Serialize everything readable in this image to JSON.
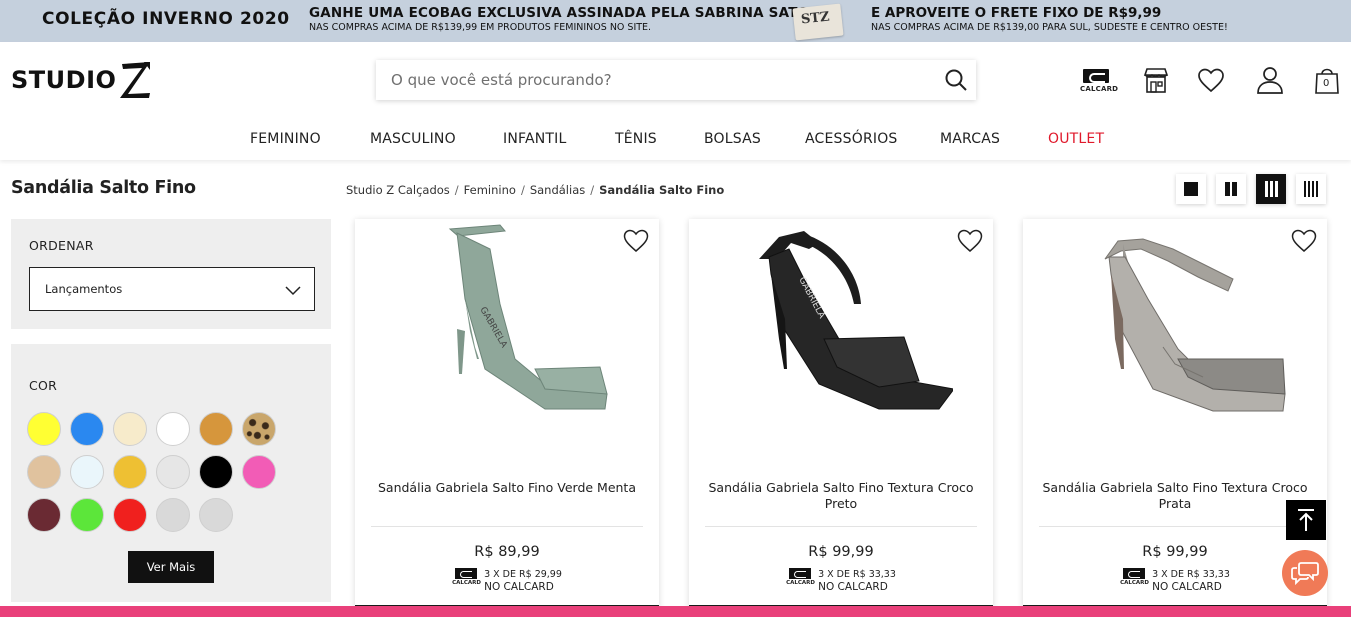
{
  "promo": {
    "left": "COLEÇÃO INVERNO 2020",
    "mid_big": "GANHE UMA ECOBAG EXCLUSIVA ASSINADA PELA SABRINA SATO",
    "mid_small": "NAS COMPRAS ACIMA DE R$139,99 EM PRODUTOS FEMININOS NO SITE.",
    "bag_label": "STZ",
    "right_big": "E APROVEITE O FRETE FIXO DE R$9,99",
    "right_small": "NAS COMPRAS ACIMA DE R$139,00 PARA SUL, SUDESTE E CENTRO OESTE!"
  },
  "header": {
    "logo_text": "STUDIO",
    "search_placeholder": "O que você está procurando?",
    "calcard_label": "CALCARD",
    "icons": [
      "calcard-icon",
      "store-icon",
      "heart-icon",
      "user-icon",
      "bag-icon"
    ],
    "cart_count": "0"
  },
  "nav": [
    {
      "label": "FEMININO"
    },
    {
      "label": "MASCULINO"
    },
    {
      "label": "INFANTIL"
    },
    {
      "label": "TÊNIS"
    },
    {
      "label": "BOLSAS"
    },
    {
      "label": "ACESSÓRIOS"
    },
    {
      "label": "MARCAS"
    },
    {
      "label": "OUTLET"
    }
  ],
  "page": {
    "title": "Sandália Salto Fino",
    "breadcrumb": [
      "Studio Z Calçados",
      "Feminino",
      "Sandálias",
      "Sandália Salto Fino"
    ]
  },
  "filters": {
    "sort_title": "ORDENAR",
    "sort_value": "Lançamentos",
    "color_title": "COR",
    "colors": [
      "#ffff33",
      "#2a88f0",
      "#f7ebcb",
      "#ffffff",
      "#d6963c",
      "leopard",
      "#e0c29e",
      "#eaf6fb",
      "#eec033",
      "#e6e6e6",
      "#000000",
      "#f25cb6",
      "#6a2a33",
      "#5ce63a",
      "#f0201e",
      "#d9d9d9",
      "#d9d9d9"
    ],
    "more_label": "Ver Mais"
  },
  "products": [
    {
      "name": "Sandália Gabriela Salto Fino Verde Menta",
      "price": "R$ 89,99",
      "installments": "3 X DE R$ 29,99",
      "installments_suffix": "NO CALCARD",
      "calcard_label": "CALCARD",
      "color": "#8fa79a"
    },
    {
      "name": "Sandália Gabriela Salto Fino Textura Croco Preto",
      "price": "R$ 99,99",
      "installments": "3 X DE R$ 33,33",
      "installments_suffix": "NO CALCARD",
      "calcard_label": "CALCARD",
      "color": "#1d1d1d"
    },
    {
      "name": "Sandália Gabriela Salto Fino Textura Croco Prata",
      "price": "R$ 99,99",
      "installments": "3 X DE R$ 33,33",
      "installments_suffix": "NO CALCARD",
      "calcard_label": "CALCARD",
      "color": "#9b9893"
    }
  ],
  "colors": {
    "promo_bg": "#c5d0dd",
    "outlet": "#e0192b",
    "chat": "#f07a57",
    "bottom_bar": "#e9407a"
  }
}
